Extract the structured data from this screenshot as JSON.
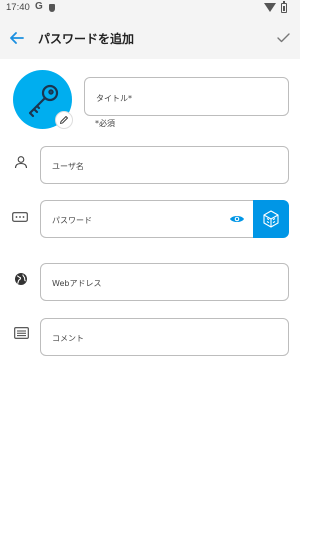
{
  "status_bar": {
    "time": "17:40",
    "g_badge": "G",
    "icons": [
      "google-icon",
      "shield-icon",
      "wifi-icon",
      "battery-icon"
    ]
  },
  "header": {
    "title": "パスワードを追加",
    "back_icon": "arrow-left-icon",
    "confirm_icon": "check-icon"
  },
  "form": {
    "title_placeholder": "タイトル*",
    "required_note": "*必須",
    "username_placeholder": "ユーザ名",
    "password_placeholder": "パスワード",
    "web_placeholder": "Webアドレス",
    "comment_placeholder": "コメント"
  },
  "colors": {
    "accent": "#00aeef",
    "generate_button": "#0096e6",
    "header_bg": "#f4f4f4"
  }
}
